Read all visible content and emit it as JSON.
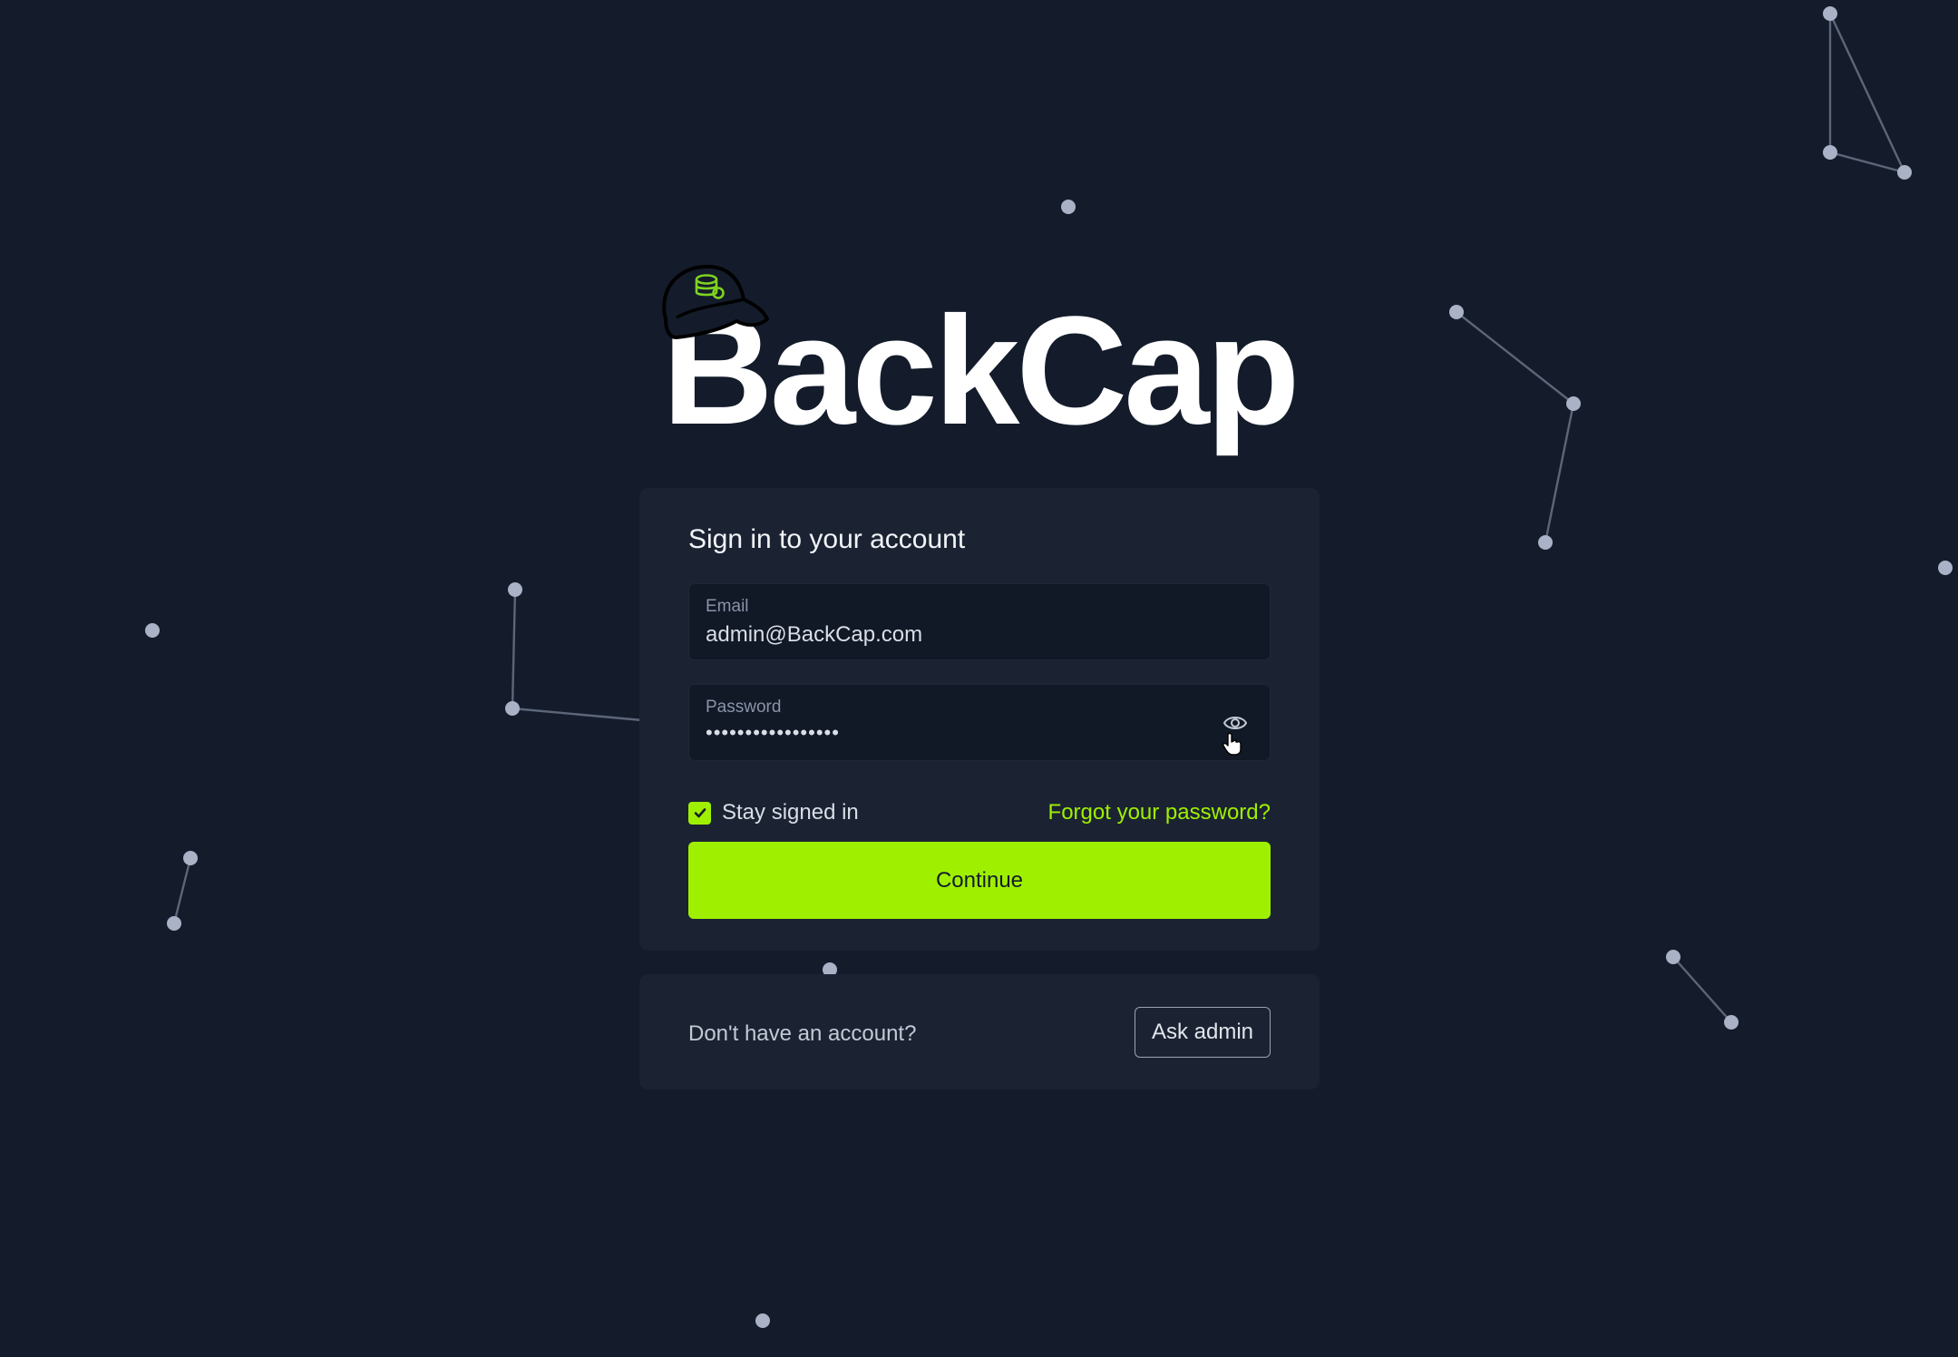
{
  "brand": {
    "name": "BackCap"
  },
  "signin": {
    "title": "Sign in to your account",
    "email": {
      "label": "Email",
      "value": "admin@BackCap.com"
    },
    "password": {
      "label": "Password",
      "masked_value": "•••••••••••••••••"
    },
    "stay_signed_in": {
      "label": "Stay signed in",
      "checked": true
    },
    "forgot_link": "Forgot your password?",
    "continue_label": "Continue"
  },
  "signup": {
    "prompt": "Don't have an account?",
    "ask_admin_label": "Ask admin"
  },
  "colors": {
    "background": "#141c2b",
    "card": "#1b2333",
    "input": "#111826",
    "accent": "#9ff000",
    "node": "#a9b2c6"
  },
  "icons": [
    "baseball-cap-icon",
    "eye-icon",
    "hand-cursor-icon",
    "checkmark-icon"
  ]
}
